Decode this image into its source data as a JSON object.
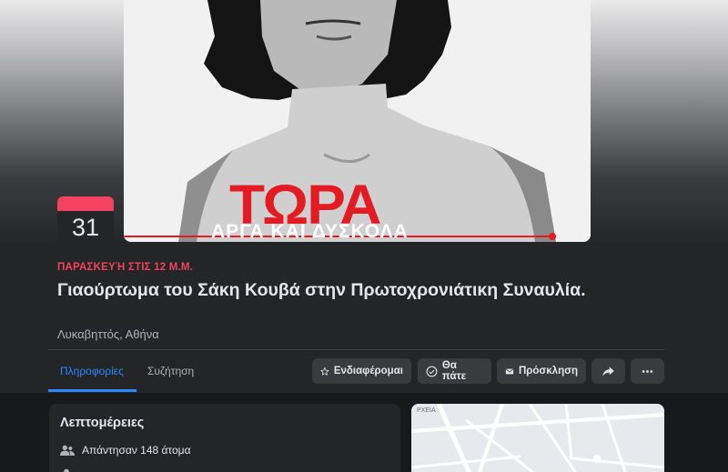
{
  "cover": {
    "title": "ΤΩΡΑ",
    "subtitle": "ΑΡΓΑ ΚΑΙ ΔΥΣΚΟΛΑ"
  },
  "event": {
    "day": "31",
    "date_text": "ΠΑΡΑΣΚΕΥΉ ΣΤΙΣ 12 Μ.Μ.",
    "title": "Γιαούρτωμα του Σάκη Κουβά στην Πρωτοχρονιάτικη Συναυλία.",
    "location": "Λυκαβηττός, Αθήνα"
  },
  "tabs": [
    {
      "label": "Πληροφορίες",
      "active": true
    },
    {
      "label": "Συζήτηση",
      "active": false
    }
  ],
  "actions": {
    "interested": "Ενδιαφέρομαι",
    "going": "Θα πάτε",
    "invite": "Πρόσκληση"
  },
  "details": {
    "title": "Λεπτομέρειες",
    "responded": "Απάντησαν 148 άτομα"
  },
  "map": {
    "label": "ΡΧΕΙΑ"
  },
  "colors": {
    "accent": "#2d88ff",
    "date_red": "#f3425f",
    "background": "#18191a",
    "surface": "#242526",
    "button": "#3a3b3c"
  }
}
